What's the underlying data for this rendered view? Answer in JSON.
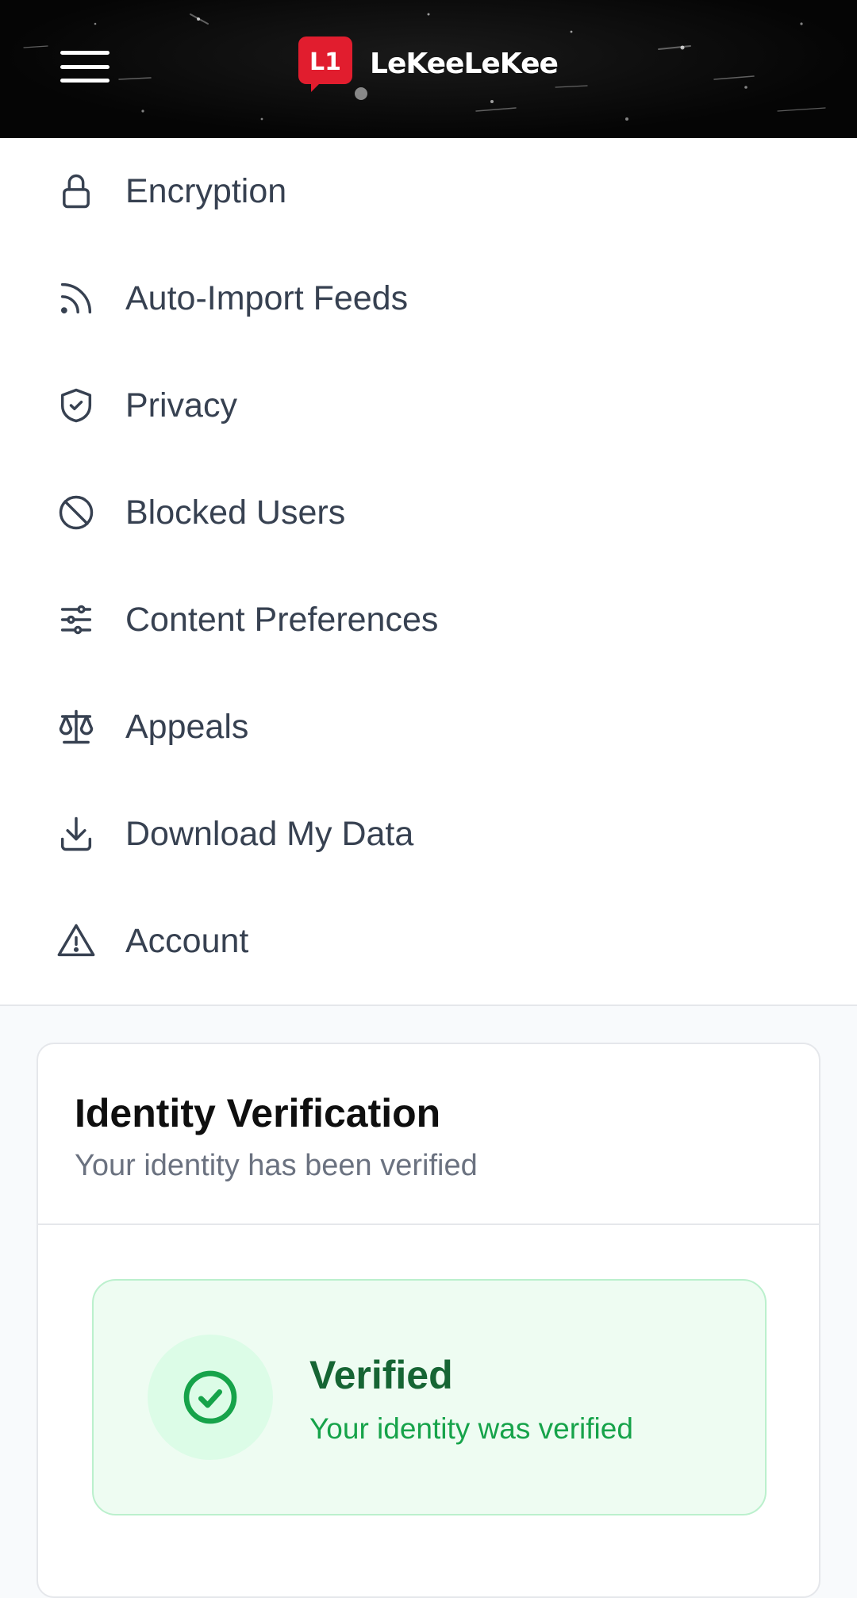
{
  "header": {
    "logo_badge": "L1",
    "logo_text": "LeKeeLeKee"
  },
  "settings": {
    "items": [
      {
        "label": "Encryption",
        "icon": "lock-icon"
      },
      {
        "label": "Auto-Import Feeds",
        "icon": "rss-icon"
      },
      {
        "label": "Privacy",
        "icon": "shield-check-icon"
      },
      {
        "label": "Blocked Users",
        "icon": "ban-icon"
      },
      {
        "label": "Content Preferences",
        "icon": "sliders-icon"
      },
      {
        "label": "Appeals",
        "icon": "scale-icon"
      },
      {
        "label": "Download My Data",
        "icon": "download-icon"
      },
      {
        "label": "Account",
        "icon": "warning-triangle-icon"
      }
    ]
  },
  "identity": {
    "title": "Identity Verification",
    "subtitle": "Your identity has been verified",
    "status_title": "Verified",
    "status_subtitle": "Your identity was verified"
  },
  "colors": {
    "header_bg": "#050505",
    "logo_red": "#e11d2e",
    "text": "#374151",
    "verified_green": "#16a34a",
    "verified_dark_green": "#166534",
    "verified_bg": "#eefcf2"
  }
}
